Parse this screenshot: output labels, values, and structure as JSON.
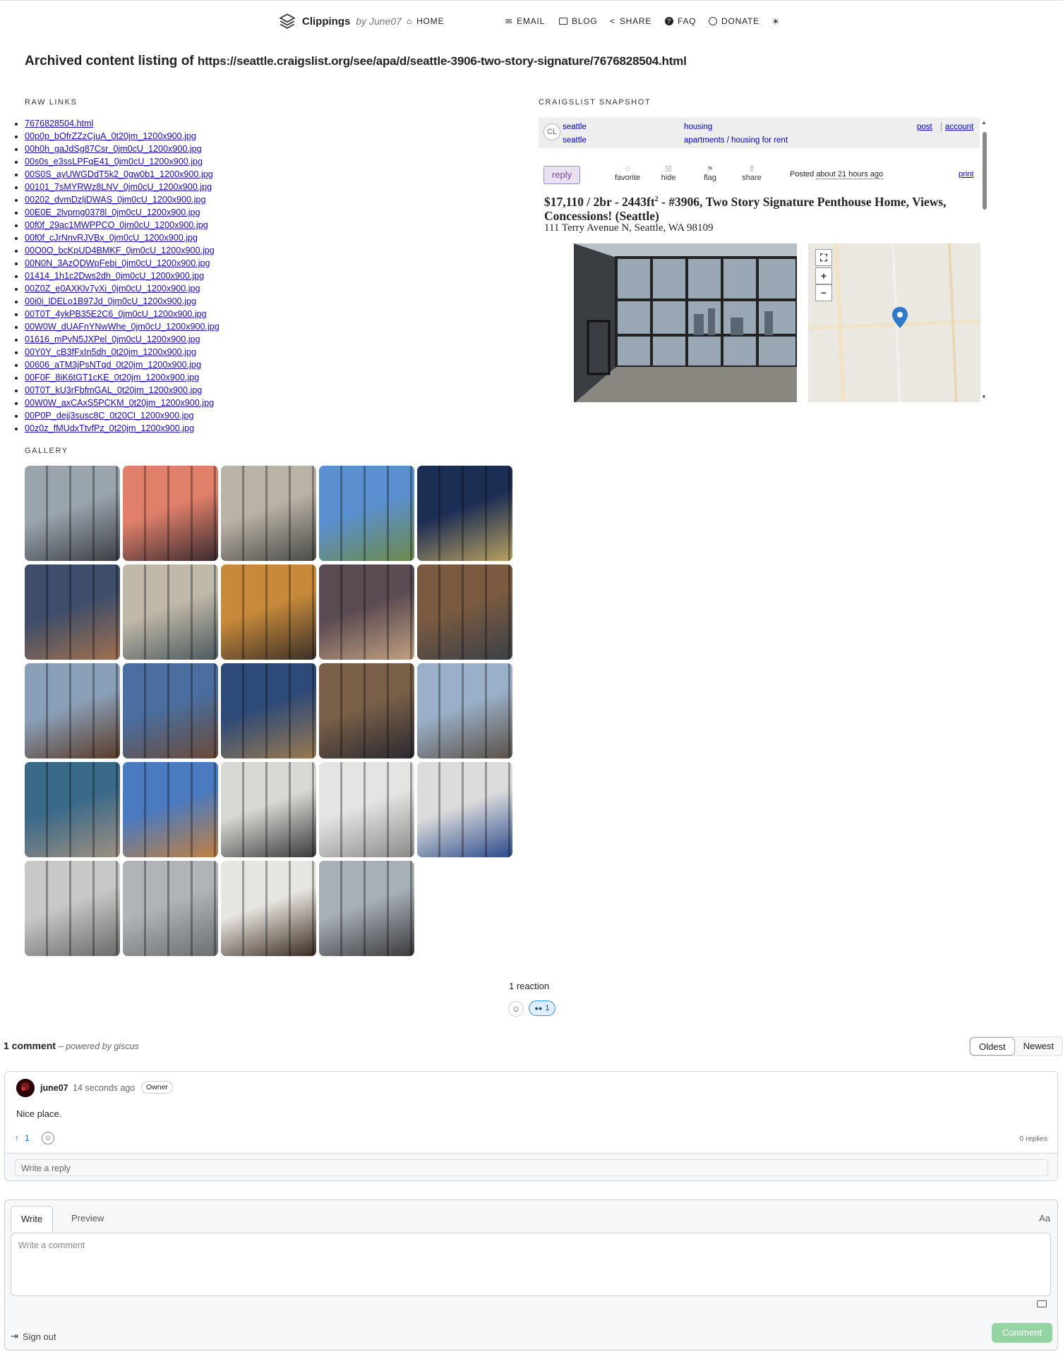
{
  "nav": {
    "brand": "Clippings",
    "by": "by June07",
    "home": "HOME",
    "email": "EMAIL",
    "blog": "BLOG",
    "share": "SHARE",
    "faq": "FAQ",
    "donate": "DONATE"
  },
  "heading": {
    "prefix": "Archived content listing of",
    "url": "https://seattle.craigslist.org/see/apa/d/seattle-3906-two-story-signature/7676828504.html"
  },
  "sections": {
    "raw_links": "RAW LINKS",
    "gallery": "GALLERY",
    "snapshot": "CRAIGSLIST SNAPSHOT"
  },
  "links": [
    "7676828504.html",
    "00p0p_bOfrZZzCjuA_0t20jm_1200x900.jpg",
    "00h0h_gaJdSg87Csr_0jm0cU_1200x900.jpg",
    "00s0s_e3ssLPFqE41_0jm0cU_1200x900.jpg",
    "00S0S_ayUWGDdT5k2_0gw0b1_1200x900.jpg",
    "00101_7sMYRWz8LNV_0jm0cU_1200x900.jpg",
    "00202_dvmDzljDWAS_0jm0cU_1200x900.jpg",
    "00E0E_2lvpmg0378l_0jm0cU_1200x900.jpg",
    "00f0f_29ac1MWPPCO_0jm0cU_1200x900.jpg",
    "00f0f_cJrNnvRJVBx_0jm0cU_1200x900.jpg",
    "00O0O_bcKpUD4BMKF_0jm0cU_1200x900.jpg",
    "00N0N_3AzQDWpFebi_0jm0cU_1200x900.jpg",
    "01414_1h1c2Dws2dh_0jm0cU_1200x900.jpg",
    "00Z0Z_e0AXKlv7yXi_0jm0cU_1200x900.jpg",
    "00i0i_lDELo1B97Jd_0jm0cU_1200x900.jpg",
    "00T0T_4ykPB35E2C6_0jm0cU_1200x900.jpg",
    "00W0W_dUAFnYNwWhe_0jm0cU_1200x900.jpg",
    "01616_mPvN5JXPel_0jm0cU_1200x900.jpg",
    "00Y0Y_cB3fFxIn5dh_0t20jm_1200x900.jpg",
    "00606_aTM3jPsNTqd_0t20jm_1200x900.jpg",
    "00F0F_8iK6tGT1cKE_0t20jm_1200x900.jpg",
    "00T0T_kU3rFbfmGAL_0t20jm_1200x900.jpg",
    "00W0W_axCAxS5PCKM_0t20jm_1200x900.jpg",
    "00P0P_dejj3susc8C_0t20Cl_1200x900.jpg",
    "00z0z_fMUdxTtvfPz_0t20jm_1200x900.jpg"
  ],
  "gallery": [
    {
      "c1": "#9aa4ad",
      "c2": "#3b3f44"
    },
    {
      "c1": "#e0806a",
      "c2": "#3a2a30"
    },
    {
      "c1": "#b9b2a6",
      "c2": "#4a4a46"
    },
    {
      "c1": "#5a8fd0",
      "c2": "#6d8a4a"
    },
    {
      "c1": "#1d2e55",
      "c2": "#b8a060"
    },
    {
      "c1": "#3d4d6a",
      "c2": "#a07050"
    },
    {
      "c1": "#c0b8a8",
      "c2": "#4c5a5e"
    },
    {
      "c1": "#c88a3a",
      "c2": "#3a3028"
    },
    {
      "c1": "#5a4a52",
      "c2": "#c0a080"
    },
    {
      "c1": "#7a5a40",
      "c2": "#3a4048"
    },
    {
      "c1": "#8aa0b8",
      "c2": "#5a3a28"
    },
    {
      "c1": "#4a6ea0",
      "c2": "#6a4a38"
    },
    {
      "c1": "#2e4a78",
      "c2": "#9a7a50"
    },
    {
      "c1": "#7a6048",
      "c2": "#2a2a30"
    },
    {
      "c1": "#9ab0c8",
      "c2": "#5a5048"
    },
    {
      "c1": "#3a6a8a",
      "c2": "#a09080"
    },
    {
      "c1": "#4a7ac0",
      "c2": "#c08040"
    },
    {
      "c1": "#d8d8d4",
      "c2": "#3a3a3a"
    },
    {
      "c1": "#e4e4e2",
      "c2": "#8a8a88"
    },
    {
      "c1": "#dcdcdc",
      "c2": "#2a4a8a"
    },
    {
      "c1": "#c8c8c6",
      "c2": "#6a6a68"
    },
    {
      "c1": "#b0b4b8",
      "c2": "#6a6e70"
    },
    {
      "c1": "#e8e6e0",
      "c2": "#3a2a20"
    },
    {
      "c1": "#a8b0b8",
      "c2": "#3a3a3c"
    }
  ],
  "craigslist": {
    "logo": "CL",
    "area1": "seattle",
    "area2": "seattle",
    "cat1": "housing",
    "cat2": "apartments / housing for rent",
    "post": "post",
    "account": "account",
    "reply": "reply",
    "favorite": "favorite",
    "hide": "hide",
    "flag": "flag",
    "share": "share",
    "posted_label": "Posted",
    "posted_time": "about 21 hours ago",
    "print": "print",
    "title_pre": "$17,110 / 2br - 2443ft",
    "title_sup": "2",
    "title_post": " - #3906, Two Story Signature Penthouse Home, Views, Concessions! (Seattle)",
    "address": "111 Terry Avenue N, Seattle, WA 98109"
  },
  "reactions": {
    "count_label": "1 reaction",
    "pill_count": "1"
  },
  "comments": {
    "count": "1 comment",
    "powered": "– powered by giscus",
    "oldest": "Oldest",
    "newest": "Newest",
    "author": "june07",
    "time": "14 seconds ago",
    "badge": "Owner",
    "body": "Nice place.",
    "upvotes": "1",
    "replies": "0 replies",
    "reply_placeholder": "Write a reply",
    "write_tab": "Write",
    "preview_tab": "Preview",
    "aa": "Aa",
    "comment_placeholder": "Write a comment",
    "signout": "Sign out",
    "submit": "Comment"
  }
}
